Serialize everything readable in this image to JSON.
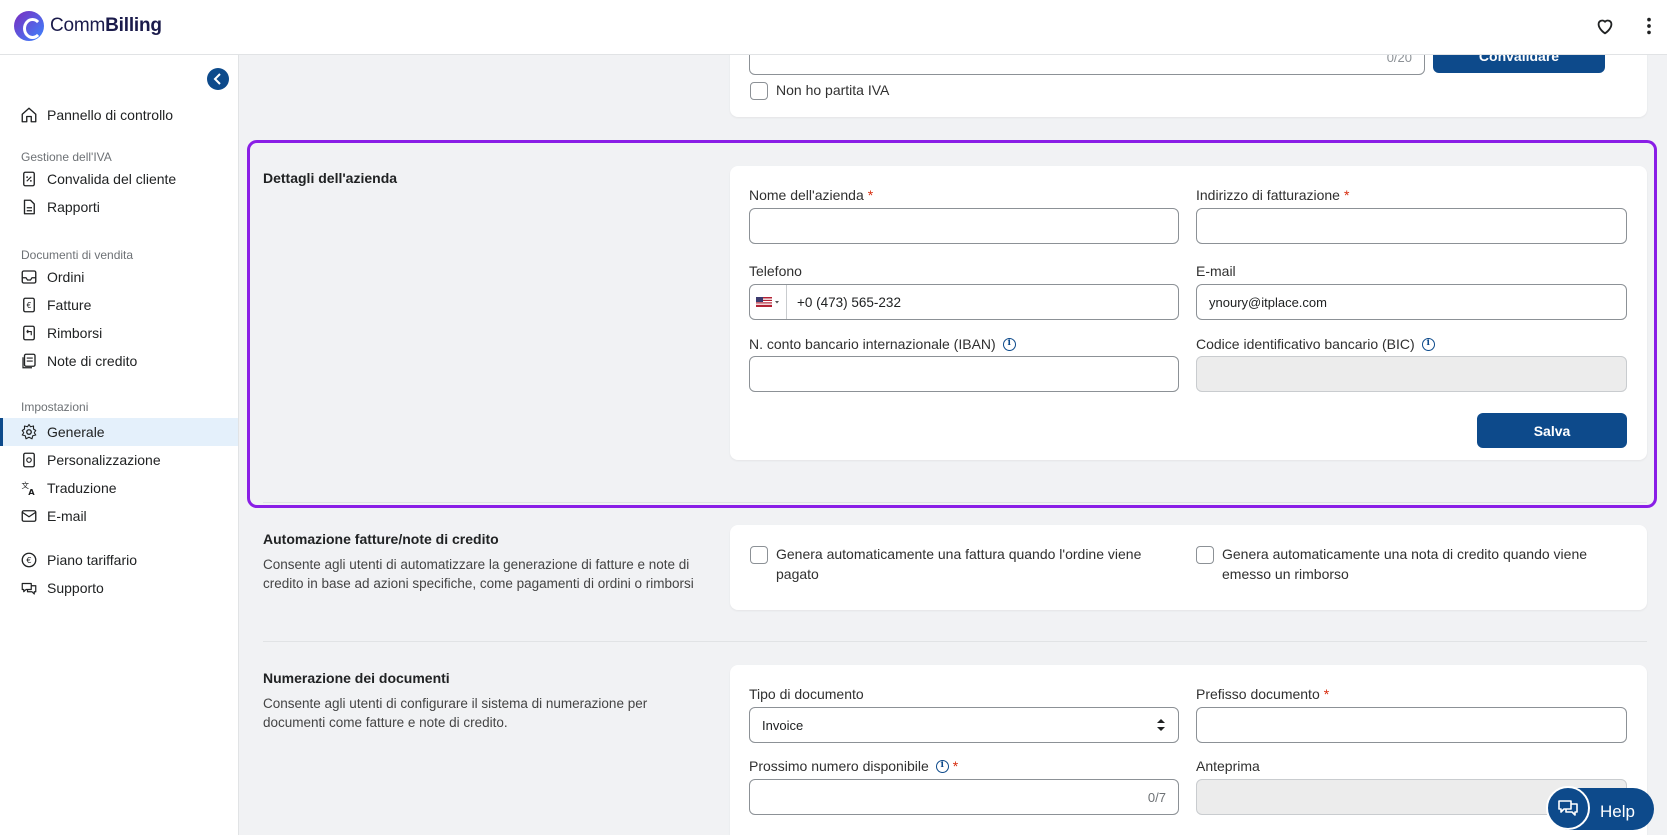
{
  "app": {
    "name_regular": "Comm",
    "name_bold": "Billing"
  },
  "sidebar": {
    "dashboard": "Pannello di controllo",
    "vat_section": "Gestione dell'IVA",
    "vat_items": [
      "Convalida del cliente",
      "Rapporti"
    ],
    "sales_section": "Documenti di vendita",
    "sales_items": [
      "Ordini",
      "Fatture",
      "Rimborsi",
      "Note di credito"
    ],
    "settings_section": "Impostazioni",
    "settings_items": [
      "Generale",
      "Personalizzazione",
      "Traduzione",
      "E-mail"
    ],
    "bottom_items": [
      "Piano tariffario",
      "Supporto"
    ],
    "active_item": "Generale"
  },
  "vat_card": {
    "counter": "0/20",
    "validate_button": "Convalidare",
    "no_vat_label": "Non ho partita IVA"
  },
  "company": {
    "title": "Dettagli dell'azienda",
    "name_label": "Nome dell'azienda",
    "name_value": "",
    "address_label": "Indirizzo di fatturazione",
    "address_value": "",
    "phone_label": "Telefono",
    "phone_value": "+0 (473) 565-232",
    "email_label": "E-mail",
    "email_value": "ynoury@itplace.com",
    "iban_label": "N. conto bancario internazionale (IBAN)",
    "iban_value": "",
    "bic_label": "Codice identificativo bancario (BIC)",
    "bic_value": "",
    "save_button": "Salva",
    "required_mark": "*"
  },
  "automation": {
    "title": "Automazione fatture/note di credito",
    "description": "Consente agli utenti di automatizzare la generazione di fatture e note di credito in base ad azioni specifiche, come pagamenti di ordini o rimborsi",
    "invoice_option": "Genera automaticamente una fattura quando l'ordine viene pagato",
    "credit_option": "Genera automaticamente una nota di credito quando viene emesso un rimborso"
  },
  "numbering": {
    "title": "Numerazione dei documenti",
    "description": "Consente agli utenti di configurare il sistema di numerazione per documenti come fatture e note di credito.",
    "doc_type_label": "Tipo di documento",
    "doc_type_value": "Invoice",
    "prefix_label": "Prefisso documento",
    "next_number_label": "Prossimo numero disponibile",
    "next_number_counter": "0/7",
    "preview_label": "Anteprima"
  },
  "help": {
    "label": "Help"
  },
  "colors": {
    "primary": "#0d4a8b",
    "highlight": "#8a1ee6",
    "required": "#d72c0d"
  }
}
